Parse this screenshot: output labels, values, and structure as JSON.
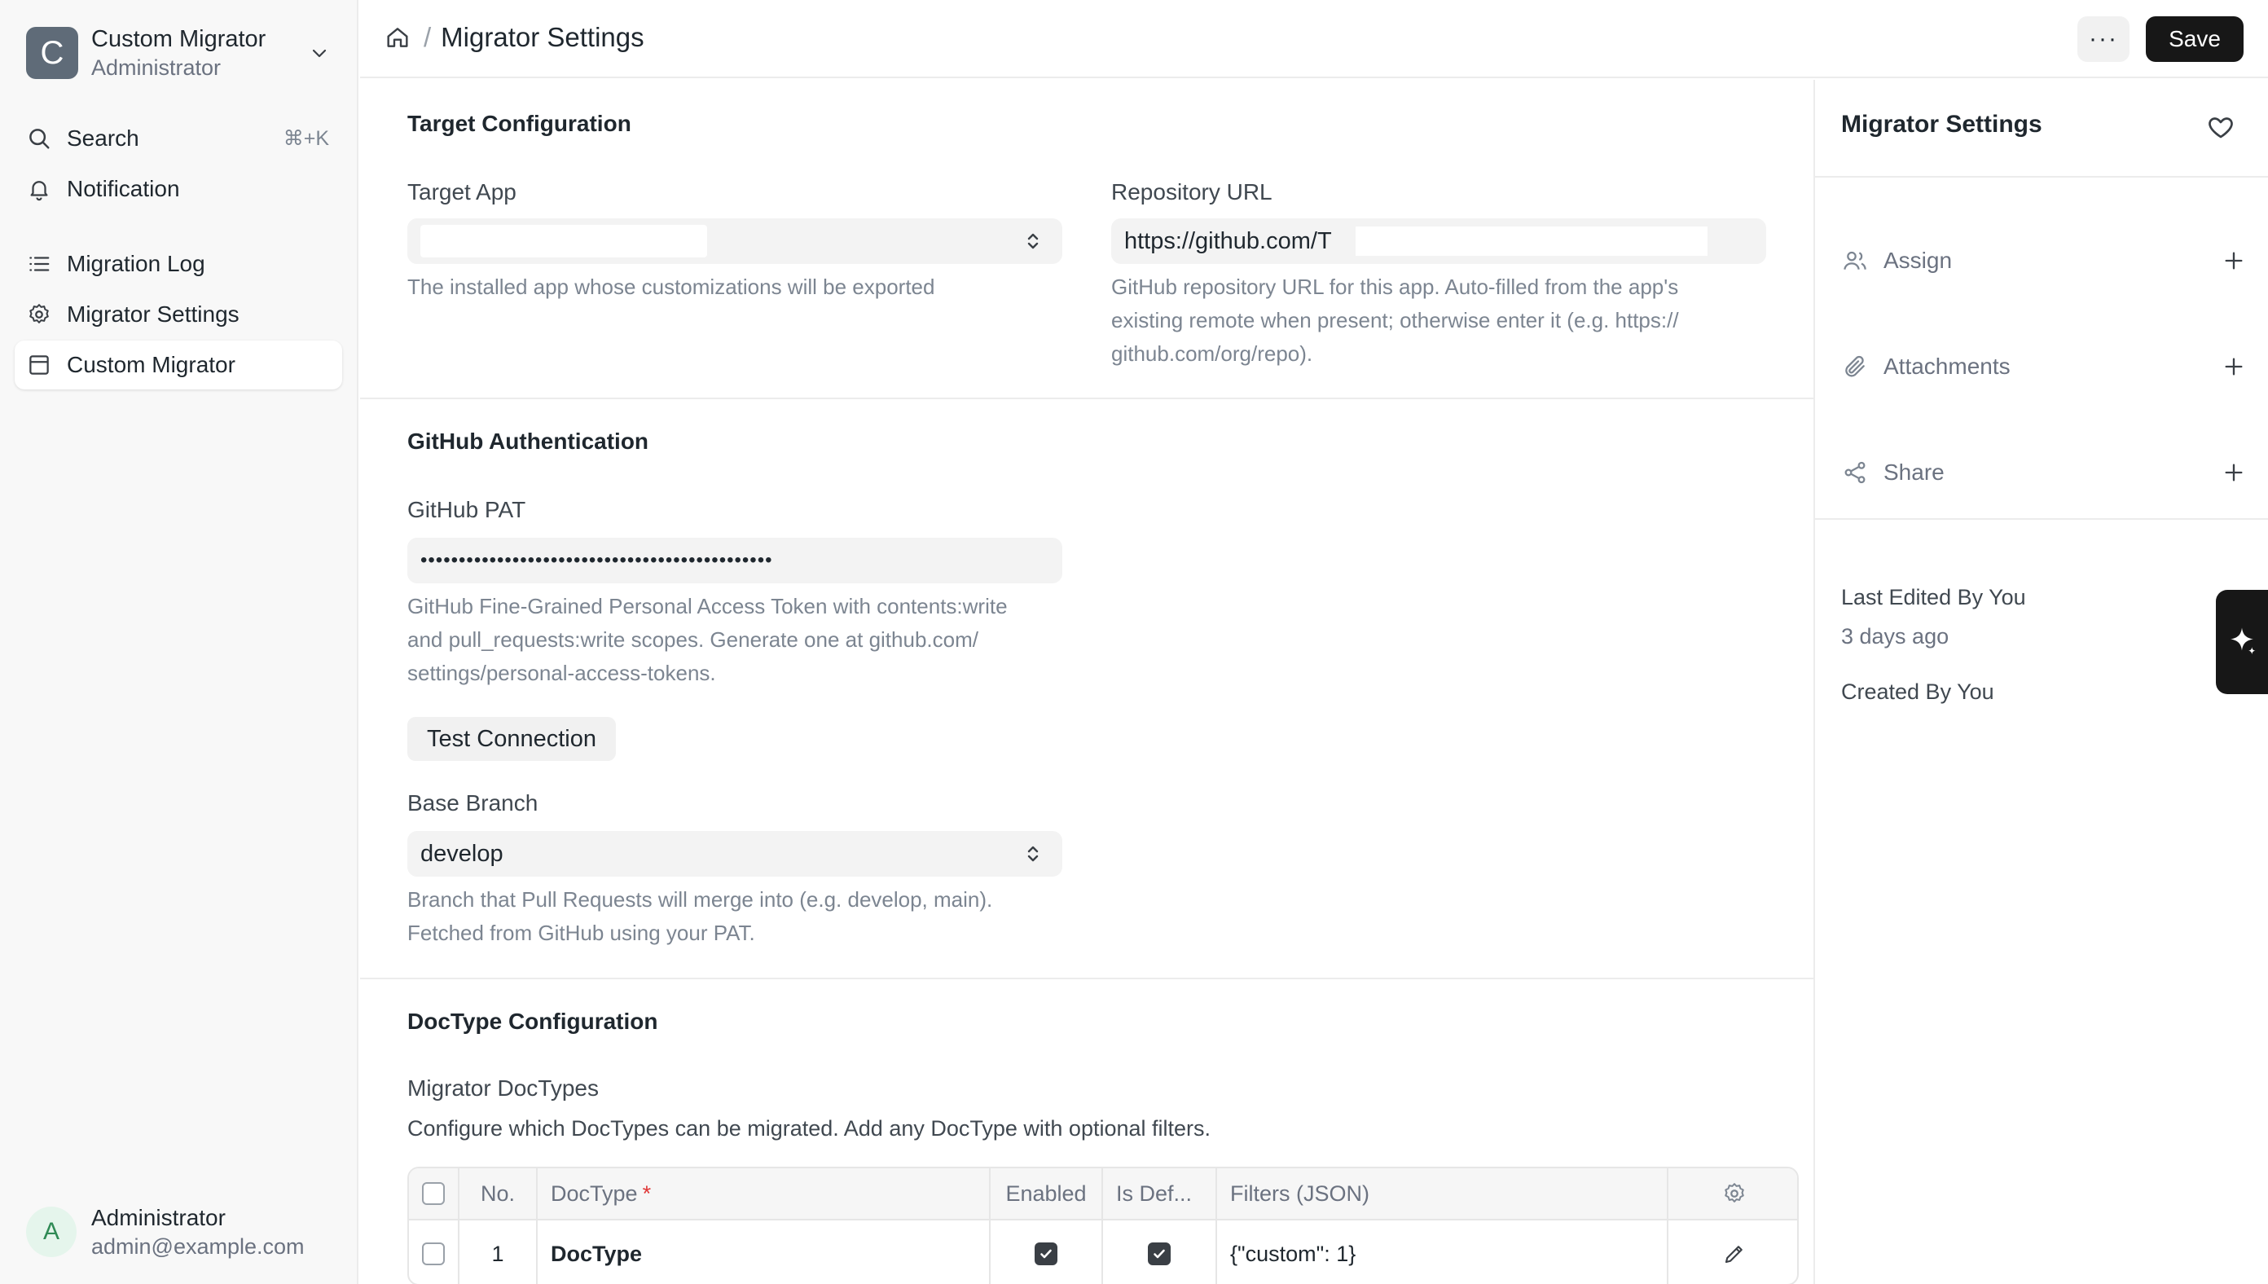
{
  "sidebar": {
    "app_logo_letter": "C",
    "app_name": "Custom Migrator",
    "app_role": "Administrator",
    "search_label": "Search",
    "search_shortcut": "⌘+K",
    "notification_label": "Notification",
    "items": [
      {
        "label": "Migration Log",
        "icon": "list-icon"
      },
      {
        "label": "Migrator Settings",
        "icon": "gear-icon"
      },
      {
        "label": "Custom Migrator",
        "icon": "layout-icon",
        "active": true
      }
    ],
    "user": {
      "initial": "A",
      "name": "Administrator",
      "email": "admin@example.com"
    }
  },
  "header": {
    "breadcrumb_sep": "/",
    "title": "Migrator Settings",
    "more_label": "···",
    "save_label": "Save"
  },
  "target_config": {
    "title": "Target Configuration",
    "target_app_label": "Target App",
    "target_app_value": "",
    "target_app_help": "The installed app whose customizations will be exported",
    "repo_url_label": "Repository URL",
    "repo_url_value": "https://github.com/T",
    "repo_url_help_1": "GitHub repository URL for this app. Auto-filled from the app's",
    "repo_url_help_2": "existing remote when present; otherwise enter it (e.g. https://",
    "repo_url_help_3": "github.com/org/repo)."
  },
  "github_auth": {
    "title": "GitHub Authentication",
    "pat_label": "GitHub PAT",
    "pat_value": "••••••••••••••••••••••••••••••••••••••••••••••",
    "pat_help_1": "GitHub Fine-Grained Personal Access Token with contents:write",
    "pat_help_2": "and pull_requests:write scopes. Generate one at github.com/",
    "pat_help_3": "settings/personal-access-tokens.",
    "test_button": "Test Connection",
    "base_branch_label": "Base Branch",
    "base_branch_value": "develop",
    "base_branch_help_1": "Branch that Pull Requests will merge into (e.g. develop, main).",
    "base_branch_help_2": "Fetched from GitHub using your PAT."
  },
  "doctype_config": {
    "title": "DocType Configuration",
    "table_label": "Migrator DocTypes",
    "table_help": "Configure which DocTypes can be migrated. Add any DocType with optional filters.",
    "columns": {
      "no": "No.",
      "doctype": "DocType",
      "required_mark": "*",
      "enabled": "Enabled",
      "is_default": "Is Def...",
      "filters": "Filters (JSON)"
    },
    "rows": [
      {
        "no": "1",
        "doctype": "DocType",
        "enabled": true,
        "is_default": true,
        "filters": "{\"custom\": 1}"
      }
    ]
  },
  "right_panel": {
    "title": "Migrator Settings",
    "assign_label": "Assign",
    "attachments_label": "Attachments",
    "share_label": "Share",
    "last_edited": "Last Edited By You",
    "last_edited_when": "3 days ago",
    "created_by": "Created By You"
  },
  "colors": {
    "primary_button": "#171717",
    "sidebar_bg": "#f8f8f8",
    "input_bg": "#f3f3f3",
    "avatar_bg": "#e5f5ec",
    "required": "#e03636"
  }
}
